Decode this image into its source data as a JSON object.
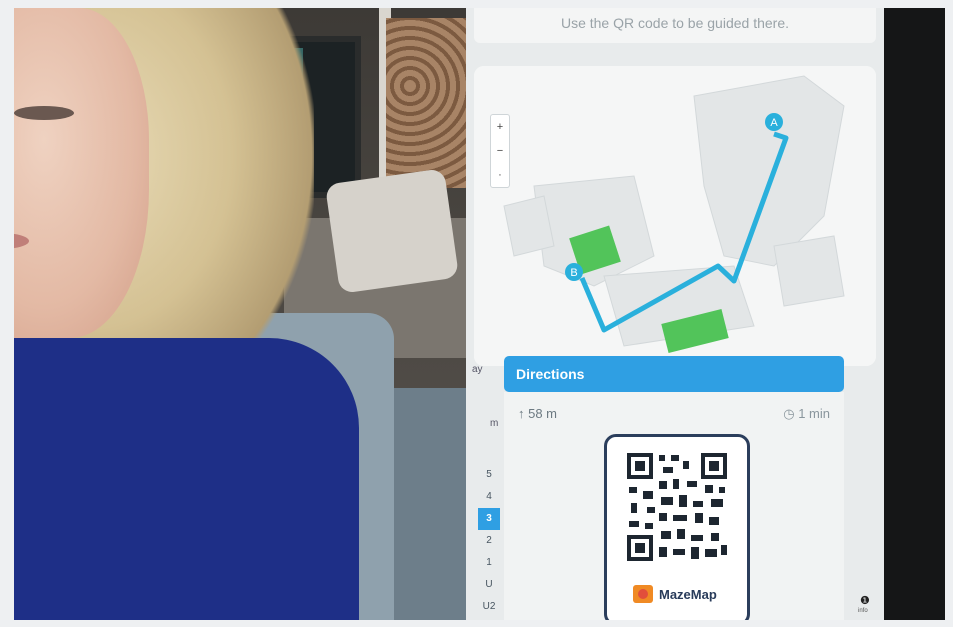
{
  "kiosk": {
    "message": "Use the QR code to be guided there.",
    "zoom": {
      "in": "+",
      "out": "−",
      "reset": "·"
    },
    "map": {
      "marker_start": "A",
      "marker_end": "B",
      "route_color": "#2ab0dc",
      "room_green": "#52c45a"
    },
    "directions_title": "Directions",
    "distance": "↑ 58 m",
    "duration": "◷ 1 min",
    "qr_brand": "MazeMap",
    "floors": [
      "5",
      "4",
      "3",
      "2",
      "1",
      "U",
      "U2"
    ],
    "active_floor": "3",
    "side_labels": {
      "left_clip": "ay",
      "small": "m"
    },
    "info_icon": "info-icon",
    "info_text": "info"
  }
}
